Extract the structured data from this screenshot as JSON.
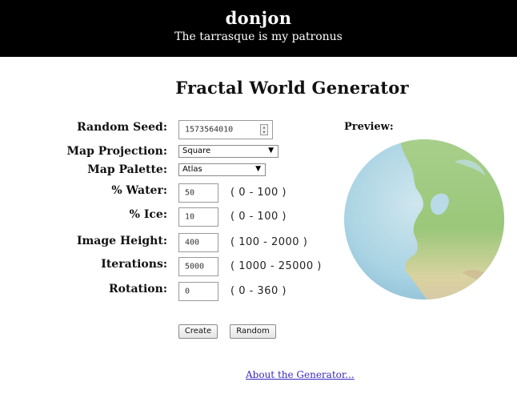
{
  "header": {
    "site_title": "donjon",
    "tagline": "The tarrasque is my patronus"
  },
  "page": {
    "title": "Fractal World Generator"
  },
  "form": {
    "seed": {
      "label": "Random Seed:",
      "value": "1573564010"
    },
    "projection": {
      "label": "Map Projection:",
      "value": "Square"
    },
    "palette": {
      "label": "Map Palette:",
      "value": "Atlas"
    },
    "water": {
      "label": "% Water:",
      "value": "50",
      "range": "( 0 - 100 )"
    },
    "ice": {
      "label": "% Ice:",
      "value": "10",
      "range": "( 0 - 100 )"
    },
    "height": {
      "label": "Image Height:",
      "value": "400",
      "range": "( 100 - 2000 )"
    },
    "iterations": {
      "label": "Iterations:",
      "value": "5000",
      "range": "( 1000 - 25000 )"
    },
    "rotation": {
      "label": "Rotation:",
      "value": "0",
      "range": "( 0 - 360 )"
    }
  },
  "buttons": {
    "create": "Create",
    "random": "Random"
  },
  "preview": {
    "label": "Preview:"
  },
  "footer": {
    "about_link": "About the Generator..."
  },
  "icons": {
    "dropdown": "chevron-down-icon",
    "spinner": "spinner-icon"
  },
  "colors": {
    "header_bg": "#000000",
    "link": "#3a2ac2",
    "ocean": "#a9d3e3",
    "land": "#9cc87a"
  }
}
